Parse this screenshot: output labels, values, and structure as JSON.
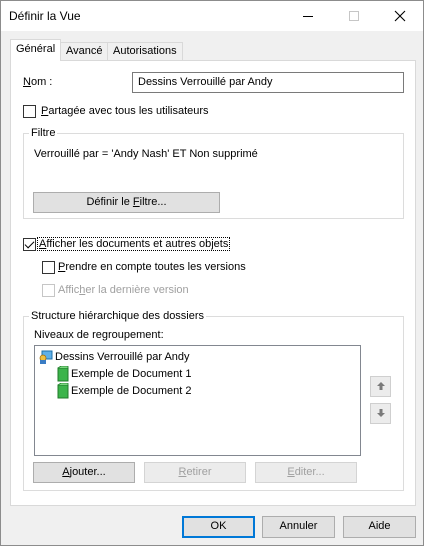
{
  "window": {
    "title": "Définir la Vue",
    "minimize_glyph": "—",
    "maximize_glyph": "☐",
    "close_glyph": "✕"
  },
  "tabs": [
    {
      "label": "Général",
      "active": true
    },
    {
      "label": "Avancé",
      "active": false
    },
    {
      "label": "Autorisations",
      "active": false
    }
  ],
  "general": {
    "name_label_pre": "",
    "name_label_u": "N",
    "name_label_post": "om :",
    "name_value": "Dessins Verrouillé par Andy",
    "shared_label_u": "P",
    "shared_label_post": "artagée avec tous les utilisateurs",
    "shared_checked": false
  },
  "filter": {
    "group_label": "Filtre",
    "text": "Verrouillé par = 'Andy Nash' ET Non supprimé",
    "define_button_pre": "Définir le ",
    "define_button_u": "F",
    "define_button_post": "iltre..."
  },
  "options": {
    "show_docs_u": "A",
    "show_docs_post": "fficher les documents et autres objets",
    "show_docs_checked": true,
    "all_versions_u": "P",
    "all_versions_post": "rendre en compte toutes les versions",
    "all_versions_checked": false,
    "last_version_pre": "Affic",
    "last_version_u": "h",
    "last_version_post": "er la dernière version",
    "last_version_checked": false
  },
  "hierarchy": {
    "group_label": "Structure hiérarchique des dossiers",
    "levels_label": "Niveaux de regroupement:",
    "tree": [
      {
        "label": "Dessins Verrouillé par Andy",
        "icon": "view-icon",
        "level": 0
      },
      {
        "label": "Exemple de Document 1",
        "icon": "document-icon",
        "level": 1
      },
      {
        "label": "Exemple de Document 2",
        "icon": "document-icon",
        "level": 1
      }
    ],
    "move_up_glyph": "🡑",
    "move_down_glyph": "🡓",
    "add_button_pre": "",
    "add_button_u": "A",
    "add_button_post": "jouter...",
    "remove_button_u": "R",
    "remove_button_post": "etirer",
    "edit_button_u": "E",
    "edit_button_post": "diter..."
  },
  "footer": {
    "ok": "OK",
    "cancel": "Annuler",
    "help": "Aide"
  },
  "colors": {
    "accent": "#0078d7",
    "document_icon": "#3cb44b",
    "view_icon": "#1e90d6"
  }
}
